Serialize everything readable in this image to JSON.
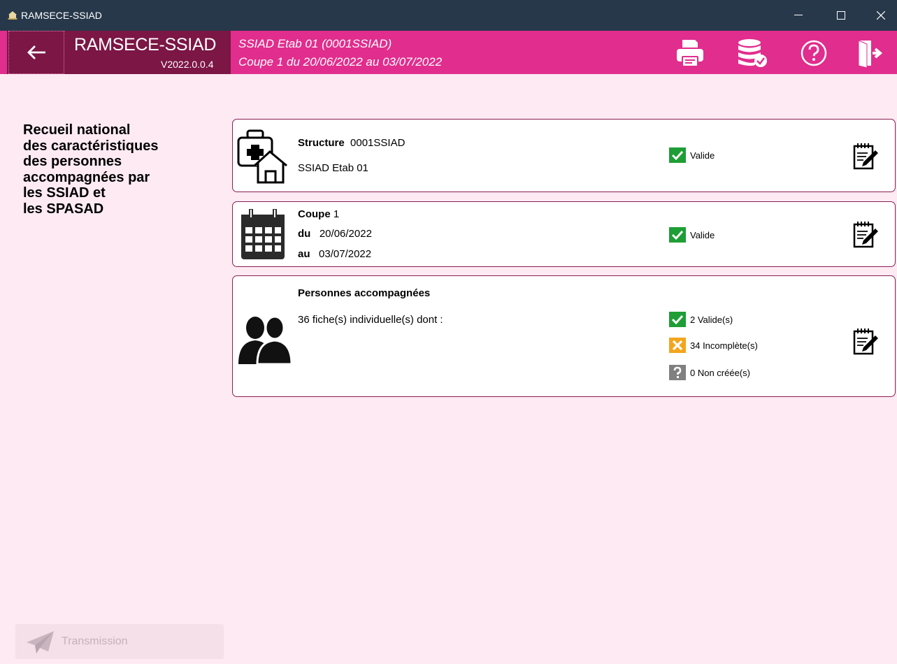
{
  "window": {
    "title": "RAMSECE-SSIAD"
  },
  "header": {
    "app_name": "RAMSECE-SSIAD",
    "version": "V2022.0.0.4",
    "context_line1": "SSIAD Etab 01 (0001SSIAD)",
    "context_line2": "Coupe 1 du 20/06/2022 au 03/07/2022",
    "icons": [
      "back-arrow-icon",
      "printer-icon",
      "database-check-icon",
      "help-icon",
      "exit-door-icon"
    ],
    "accent_color": "#e12d8d",
    "dark_accent_color": "#7b1645"
  },
  "sidebar": {
    "title_lines": [
      "Recueil national",
      "des caractéristiques",
      "des personnes",
      "accompagnées par",
      "les SSIAD et",
      "les SPASAD"
    ],
    "transmission_label": "Transmission"
  },
  "cards": {
    "structure": {
      "label": "Structure",
      "code": "0001SSIAD",
      "name": "SSIAD Etab 01",
      "status": "Valide",
      "icon": "medical-house-icon"
    },
    "coupe": {
      "label": "Coupe",
      "number": "1",
      "du_label": "du",
      "du_value": "20/06/2022",
      "au_label": "au",
      "au_value": "03/07/2022",
      "status": "Valide",
      "icon": "calendar-icon"
    },
    "personnes": {
      "label": "Personnes accompagnées",
      "summary": "36 fiche(s) individuelle(s) dont :",
      "status_valid": "2 Valide(s)",
      "status_incomplete": "34 Incomplète(s)",
      "status_not_created": "0 Non créée(s)",
      "icon": "users-icon"
    }
  },
  "colors": {
    "valid_green": "#1e9e35",
    "incomplete_orange": "#f3a51d",
    "not_created_gray": "#808080",
    "card_border": "#8a1d52",
    "page_background": "#fdeaf3"
  }
}
